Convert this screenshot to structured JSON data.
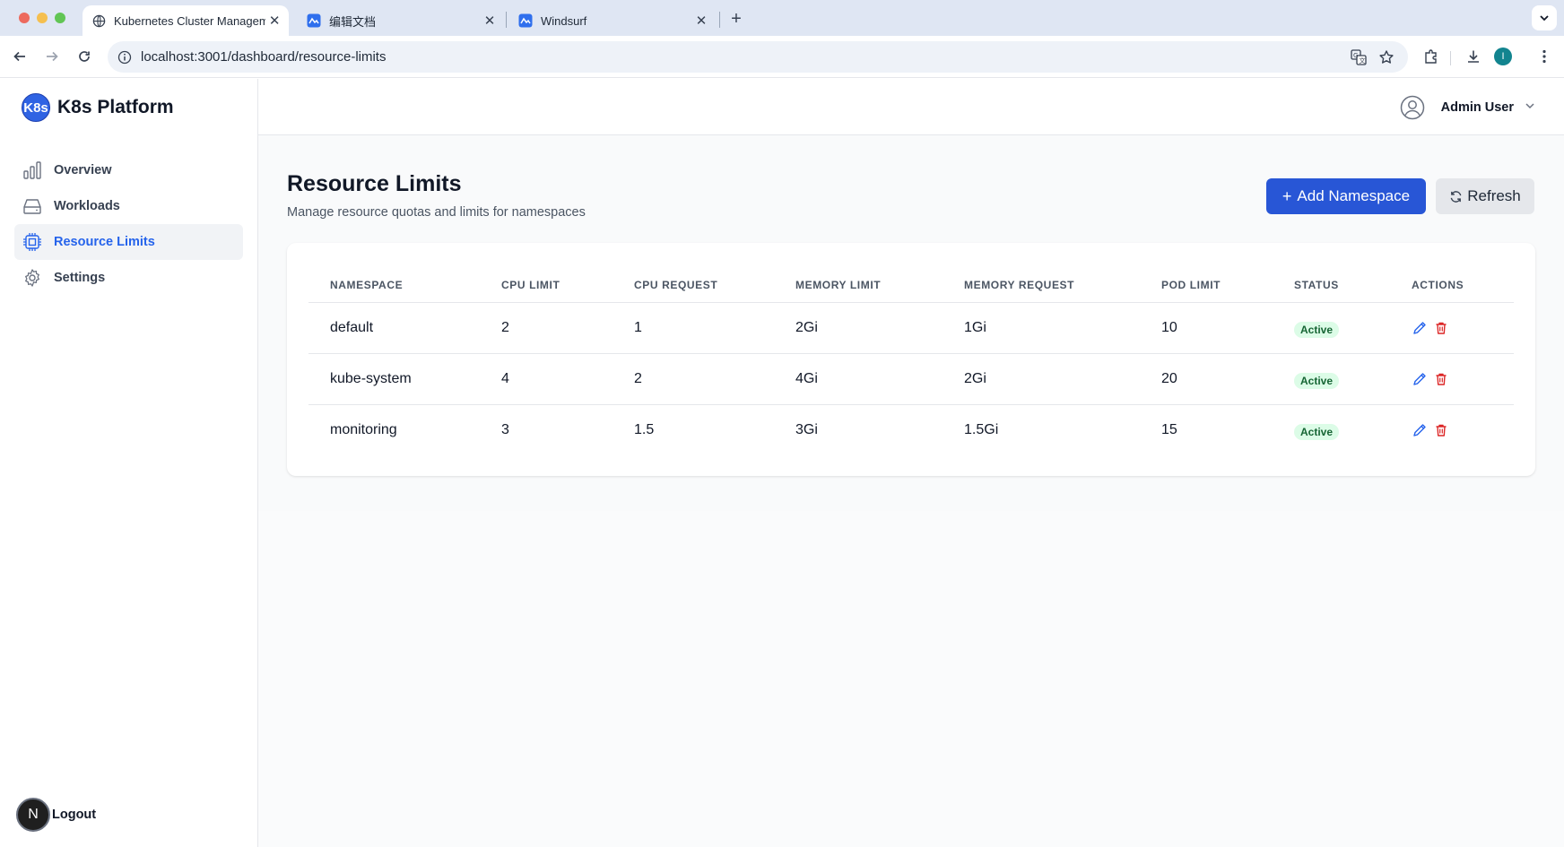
{
  "browser": {
    "tabs": [
      {
        "title": "Kubernetes Cluster Managem",
        "active": true
      },
      {
        "title": "编辑文档",
        "active": false
      },
      {
        "title": "Windsurf",
        "active": false
      }
    ],
    "url": "localhost:3001/dashboard/resource-limits",
    "profile_initial": "I"
  },
  "sidebar": {
    "logo_text": "K8s",
    "brand_name": "K8s Platform",
    "items": [
      {
        "label": "Overview",
        "icon": "bar-chart-icon",
        "active": false
      },
      {
        "label": "Workloads",
        "icon": "server-icon",
        "active": false
      },
      {
        "label": "Resource Limits",
        "icon": "cpu-chip-icon",
        "active": true
      },
      {
        "label": "Settings",
        "icon": "gear-icon",
        "active": false
      }
    ],
    "logout_avatar": "N",
    "logout_label": "Logout"
  },
  "header": {
    "user_name": "Admin User"
  },
  "page": {
    "title": "Resource Limits",
    "subtitle": "Manage resource quotas and limits for namespaces",
    "add_button": "Add Namespace",
    "add_button_icon": "+",
    "refresh_button": "Refresh"
  },
  "table": {
    "columns": [
      "NAMESPACE",
      "CPU LIMIT",
      "CPU REQUEST",
      "MEMORY LIMIT",
      "MEMORY REQUEST",
      "POD LIMIT",
      "STATUS",
      "ACTIONS"
    ],
    "rows": [
      {
        "namespace": "default",
        "cpu_limit": "2",
        "cpu_request": "1",
        "memory_limit": "2Gi",
        "memory_request": "1Gi",
        "pod_limit": "10",
        "status": "Active"
      },
      {
        "namespace": "kube-system",
        "cpu_limit": "4",
        "cpu_request": "2",
        "memory_limit": "4Gi",
        "memory_request": "2Gi",
        "pod_limit": "20",
        "status": "Active"
      },
      {
        "namespace": "monitoring",
        "cpu_limit": "3",
        "cpu_request": "1.5",
        "memory_limit": "3Gi",
        "memory_request": "1.5Gi",
        "pod_limit": "15",
        "status": "Active"
      }
    ]
  },
  "colors": {
    "primary": "#2856d6",
    "active_nav": "#2563eb",
    "status_bg": "#dcfce7",
    "status_text": "#166534",
    "edit_icon": "#2563eb",
    "delete_icon": "#dc2626"
  }
}
